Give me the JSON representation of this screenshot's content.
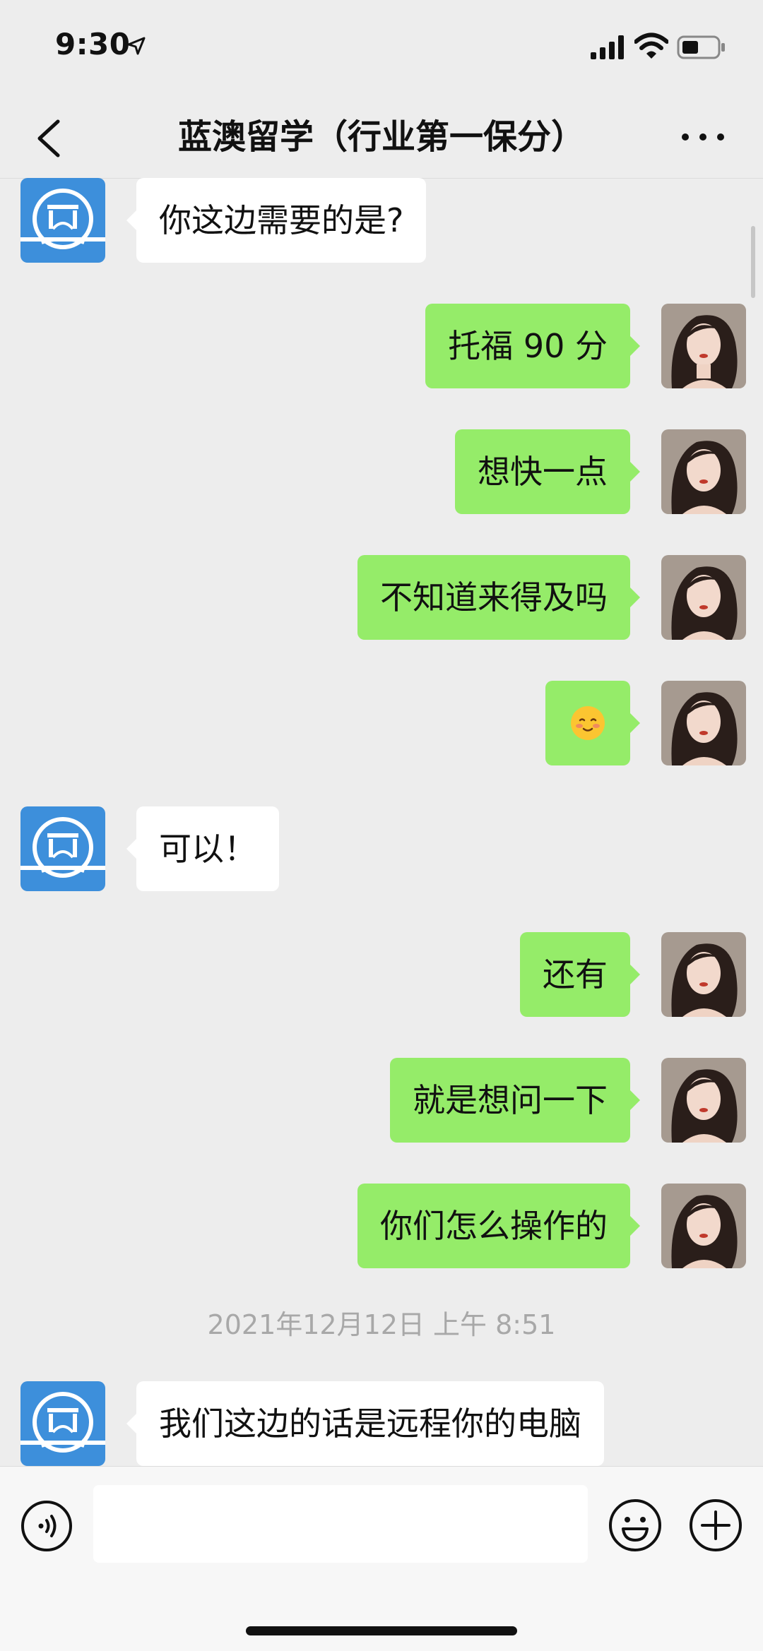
{
  "status_bar": {
    "time": "9:30"
  },
  "nav": {
    "title": "蓝澳留学（行业第一保分）"
  },
  "messages": [
    {
      "side": "left",
      "text": "你这边需要的是?"
    },
    {
      "side": "right",
      "text": "托福 90 分"
    },
    {
      "side": "right",
      "text": "想快一点"
    },
    {
      "side": "right",
      "text": "不知道来得及吗"
    },
    {
      "side": "right",
      "emoji": "smiling-blush-face"
    },
    {
      "side": "left",
      "text": "可以！"
    },
    {
      "side": "right",
      "text": "还有"
    },
    {
      "side": "right",
      "text": "就是想问一下"
    },
    {
      "side": "right",
      "text": "你们怎么操作的"
    },
    {
      "side": "left",
      "text": "我们这边的话是远程你的电脑"
    }
  ],
  "timestamp": "2021年12月12日 上午 8:51",
  "input_bar": {
    "value": "",
    "placeholder": ""
  },
  "colors": {
    "background": "#ededed",
    "sent_bubble": "#95ec69",
    "received_bubble": "#ffffff",
    "org_avatar": "#3d8fdb"
  }
}
